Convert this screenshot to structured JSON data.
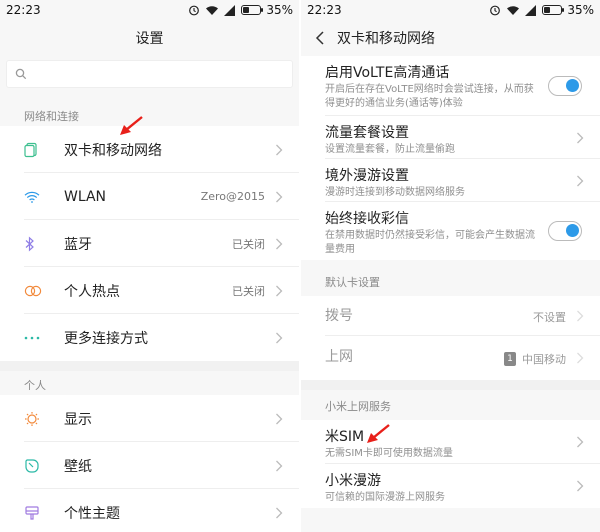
{
  "left": {
    "status": {
      "time": "22:23",
      "battery": "35%",
      "battery_level": 0.35
    },
    "title": "设置",
    "search": {
      "placeholder": ""
    },
    "sections": [
      {
        "header": "网络和连接",
        "items": [
          {
            "label": "双卡和移动网络",
            "value": "",
            "icon": "sim-card-icon",
            "color": "#3cbf8f"
          },
          {
            "label": "WLAN",
            "value": "Zero@2015",
            "icon": "wifi-icon",
            "color": "#2d9ae8"
          },
          {
            "label": "蓝牙",
            "value": "已关闭",
            "icon": "bluetooth-icon",
            "color": "#8f7ee6"
          },
          {
            "label": "个人热点",
            "value": "已关闭",
            "icon": "hotspot-icon",
            "color": "#f28a3c"
          },
          {
            "label": "更多连接方式",
            "value": "",
            "icon": "more-dots-icon",
            "color": "#2bb9a6"
          }
        ]
      },
      {
        "header": "个人",
        "items": [
          {
            "label": "显示",
            "value": "",
            "icon": "display-sun-icon",
            "color": "#f28a3c"
          },
          {
            "label": "壁纸",
            "value": "",
            "icon": "wallpaper-icon",
            "color": "#2bb9a6"
          },
          {
            "label": "个性主题",
            "value": "",
            "icon": "theme-icon",
            "color": "#a07be0"
          }
        ]
      }
    ]
  },
  "right": {
    "status": {
      "time": "22:23",
      "battery": "35%",
      "battery_level": 0.35
    },
    "title": "双卡和移动网络",
    "top_items": [
      {
        "title": "启用VoLTE高清通话",
        "desc": "开启后在存在VoLTE网络时会尝试连接，从而获得更好的通信业务(通话等)体验",
        "control": "toggle"
      },
      {
        "title": "流量套餐设置",
        "desc": "设置流量套餐，防止流量偷跑",
        "control": "chevron"
      },
      {
        "title": "境外漫游设置",
        "desc": "漫游时连接到移动数据网络服务",
        "control": "chevron"
      },
      {
        "title": "始终接收彩信",
        "desc": "在禁用数据时仍然接受彩信，可能会产生数据流量费用",
        "control": "toggle"
      }
    ],
    "default_card": {
      "header": "默认卡设置",
      "items": [
        {
          "title": "拨号",
          "value": "不设置"
        },
        {
          "title": "上网",
          "badge": "1",
          "value": "中国移动"
        }
      ]
    },
    "mi_service": {
      "header": "小米上网服务",
      "items": [
        {
          "title": "米SIM",
          "desc": "无需SIM卡即可使用数据流量"
        },
        {
          "title": "小米漫游",
          "desc": "可信赖的国际漫游上网服务"
        }
      ]
    }
  },
  "colors": {
    "accent": "#2d9ae8",
    "annotation_arrow": "#e8201a"
  }
}
